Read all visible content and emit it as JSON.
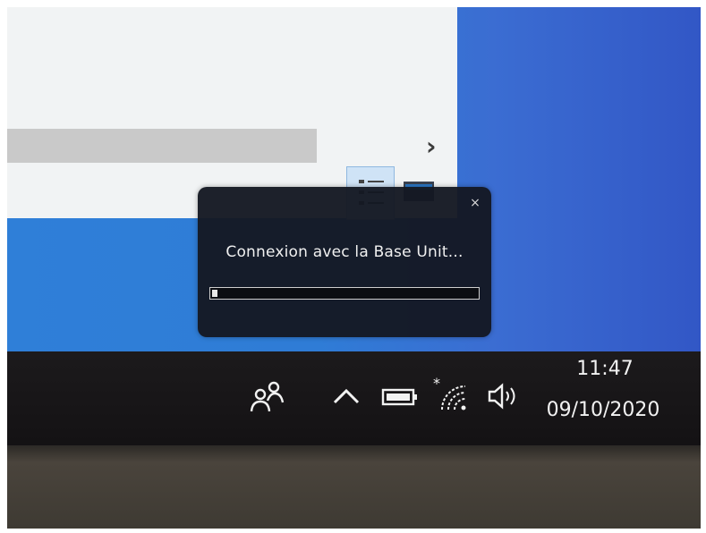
{
  "dialog": {
    "message": "Connexion avec la Base Unit...",
    "close_glyph": "×",
    "progress": 0.02
  },
  "taskbar": {
    "clock_time": "11:47",
    "clock_date": "09/10/2020",
    "tray_icons": [
      "people-icon",
      "chevron-up-icon",
      "battery-icon",
      "wifi-icon",
      "volume-icon"
    ]
  },
  "explorer": {
    "chevron_glyph": "›"
  },
  "colors": {
    "desktop_blue": "#2f7fd8",
    "dialog_background": "#14182280",
    "taskbar": "#1c1a1c"
  }
}
